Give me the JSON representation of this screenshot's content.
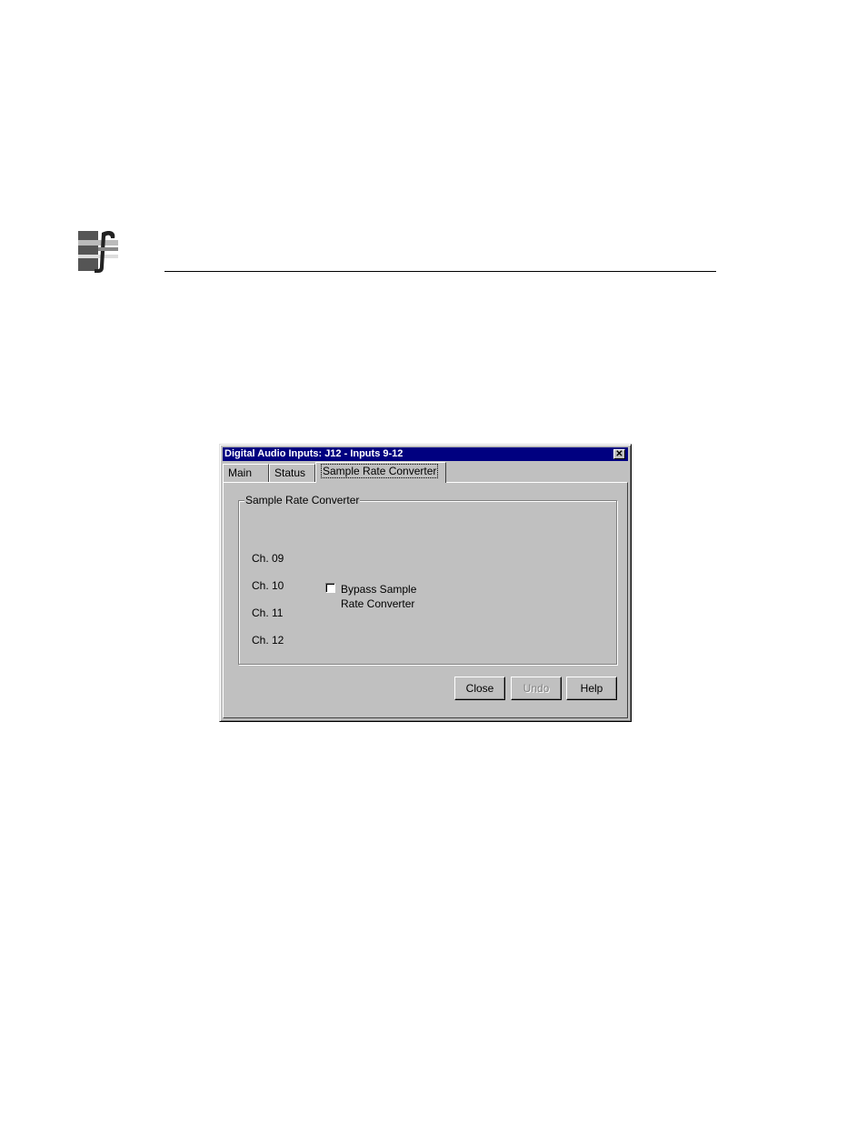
{
  "dialog": {
    "title": "Digital Audio Inputs: J12 - Inputs 9-12",
    "close_glyph": "✕"
  },
  "tabs": [
    {
      "label": "Main"
    },
    {
      "label": "Status"
    },
    {
      "label": "Sample Rate Converter",
      "active": true
    }
  ],
  "group": {
    "title": "Sample Rate Converter",
    "channels": [
      "Ch. 09",
      "Ch. 10",
      "Ch. 11",
      "Ch. 12"
    ],
    "bypass_checkbox": {
      "label": "Bypass Sample Rate Converter",
      "checked": false
    }
  },
  "buttons": {
    "close": "Close",
    "undo": "Undo",
    "help": "Help"
  },
  "icons": {
    "logo": "company-logo-icon",
    "close": "close-icon"
  }
}
